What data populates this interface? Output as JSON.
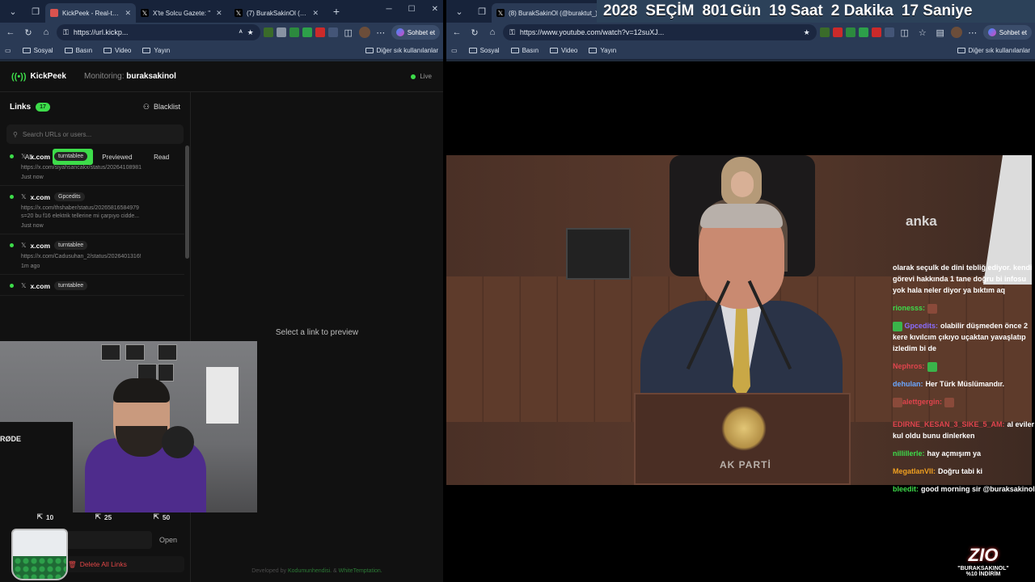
{
  "left_window": {
    "tabs": [
      {
        "label": "KickPeek - Real-time Li",
        "favicon_color": "#d9534f",
        "active": true
      },
      {
        "label": "X'te Solcu Gazete: \"",
        "favicon_color": "#000000",
        "active": false
      },
      {
        "label": "(7) BurakSakinOl (@bu",
        "favicon_color": "#000000",
        "active": false
      }
    ],
    "url": "https://url.kickp...",
    "chat_button": "Sohbet et",
    "bookmarks": [
      "Sosyal",
      "Basın",
      "Video",
      "Yayın"
    ],
    "bookmarks_other": "Diğer sık kullanılanlar"
  },
  "kickpeek": {
    "app_name": "KickPeek",
    "monitoring_label": "Monitoring:",
    "monitoring_user": "buraksakinol",
    "status": "Live",
    "links_title": "Links",
    "links_count": "17",
    "blacklist_label": "Blacklist",
    "search_placeholder": "Search URLs or users...",
    "filters": [
      "All",
      "Unread",
      "Previewed",
      "Read"
    ],
    "active_filter": "Unread",
    "items": [
      {
        "domain": "x.com",
        "user": "turntablee",
        "url": "https://x.com/siyahsancakx/status/20264108981",
        "time": "Just now"
      },
      {
        "domain": "x.com",
        "user": "Gpcedits",
        "url": "https://x.com/thshaber/status/20265816584979\ns=20 bu f16 elektrik tellerine mi çarpıyo cidde...",
        "time": "Just now"
      },
      {
        "domain": "x.com",
        "user": "turntablee",
        "url": "https://x.com/Cadusuhan_2/status/2026401316!",
        "time": "1m ago"
      },
      {
        "domain": "x.com",
        "user": "turntablee",
        "url": "",
        "time": ""
      }
    ],
    "stats": [
      "10",
      "25",
      "50"
    ],
    "open_label": "Open",
    "delete_label": "Delete All Links",
    "preview_message": "Select a link to preview",
    "footer_prefix": "Developed by",
    "footer_dev1": "Kodumunhendisi.",
    "footer_sep": "&",
    "footer_dev2": "WhiteTemptation."
  },
  "right_window": {
    "tab_label": "(8) BurakSakinOl (@buraktut_) / X",
    "url": "https://www.youtube.com/watch?v=12suXJ...",
    "chat_button": "Sohbet et",
    "bookmarks": [
      "Sosyal",
      "Basın",
      "Video",
      "Yayın"
    ],
    "bookmarks_other": "Diğer sık kullanılanlar"
  },
  "countdown": {
    "year": "2028",
    "event": "SEÇİM",
    "days": "801",
    "days_label": "Gün",
    "hours": "19",
    "hours_label": "Saat",
    "minutes": "2",
    "minutes_label": "Dakika",
    "seconds": "17",
    "seconds_label": "Saniye"
  },
  "video": {
    "watermark": "anka",
    "podium_text": "AK PARTİ"
  },
  "stream_chat": [
    {
      "user": "",
      "user_color": "#ffffff",
      "text": "olarak seçulk de dini tebliğ ediyor. kendi görevi hakkında 1 tane doğru bi infosu yok hala neler diyor ya bıktım aq"
    },
    {
      "user": "rionesss:",
      "user_color": "#3ddc4a",
      "text": ""
    },
    {
      "user": "Gpcedits:",
      "user_color": "#8a6cff",
      "text": "olabilir düşmeden önce 2 kere kıvılcım çıkıyo uçaktan yavaşlatıp izledim bi de"
    },
    {
      "user": "Nephros:",
      "user_color": "#e0444d",
      "text": ""
    },
    {
      "user": "dehulan:",
      "user_color": "#6aa6ff",
      "text": "Her Türk Müslümandır."
    },
    {
      "user": "alettgergin:",
      "user_color": "#e0444d",
      "text": ""
    },
    {
      "user": "EDIRNE_KESAN_3_SIKE_5_AM:",
      "user_color": "#e0444d",
      "text": "al eviler kul oldu bunu dinlerken"
    },
    {
      "user": "nillillerle:",
      "user_color": "#3ddc4a",
      "text": "hay açmışım ya"
    },
    {
      "user": "MegatlanVII:",
      "user_color": "#f0a020",
      "text": "Doğru tabi ki"
    },
    {
      "user": "bleedit:",
      "user_color": "#3ddc4a",
      "text": "good morning sir @buraksakinol"
    }
  ],
  "sponsor": {
    "logo": "ZIO",
    "line1": "\"BURAKSAKINOL\"",
    "line2": "%10 İNDİRİM"
  },
  "webcam": {
    "brand": "RØDE"
  }
}
